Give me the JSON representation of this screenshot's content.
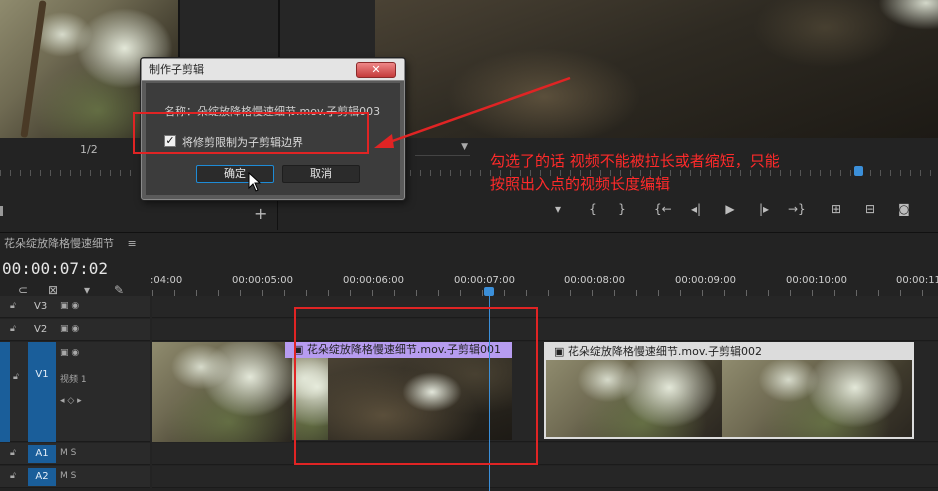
{
  "dialog": {
    "title": "制作子剪辑",
    "close": "✕",
    "name_label": "名称：",
    "name_value": "朵绽放降格慢速细节.mov.子剪辑003",
    "checkbox_label": "将修剪限制为子剪辑边界",
    "checkbox_checked": "✓",
    "ok": "确定",
    "cancel": "取消"
  },
  "annotation": {
    "line1": "勾选了的话 视频不能被拉长或者缩短，只能",
    "line2": "按照出入点的视频长度编辑"
  },
  "source_monitor": {
    "scale": "1/2",
    "add": "+"
  },
  "program_monitor": {
    "controls": [
      "▾",
      "{",
      "}",
      "{←",
      "◂|",
      "▶",
      "|▸",
      "→}",
      "⊞",
      "⊟",
      "◙"
    ]
  },
  "timeline": {
    "sequence_name": "花朵绽放降格慢速细节",
    "menu_icon": "≡",
    "timecode": "00:00:07:02",
    "ruler": [
      ":04:00",
      "00:00:05:00",
      "00:00:06:00",
      "00:00:07:00",
      "00:00:08:00",
      "00:00:09:00",
      "00:00:10:00",
      "00:00:11"
    ],
    "tracks": [
      {
        "name": "V3"
      },
      {
        "name": "V2"
      },
      {
        "name": "V1",
        "label": "视频 1"
      },
      {
        "name": "A1",
        "icons": "M S"
      },
      {
        "name": "A2",
        "icons": "M S"
      }
    ],
    "clips": [
      {
        "title": "花朵绽放降格慢速细节.mov.子剪辑001",
        "marker": "▣"
      },
      {
        "title": "花朵绽放降格慢速细节.mov.子剪辑002",
        "marker": "▣"
      }
    ]
  },
  "colors": {
    "accent": "#1e8bd6",
    "annotation": "#e02424",
    "clip_purple": "#b79cf0",
    "workbar": "#e0c000"
  }
}
